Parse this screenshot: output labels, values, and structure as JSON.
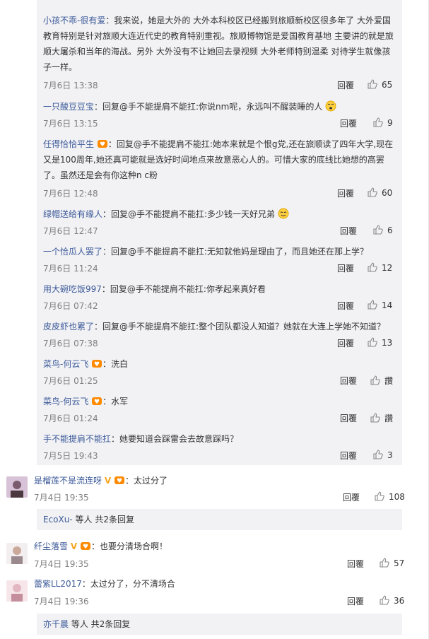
{
  "replies": [
    {
      "name": "小孩不乖-很有爱",
      "text": "：我来说，她是大外的 大外本科校区已经搬到旅顺新校区很多年了 大外爱国教育特别是针对旅顺大连近代史的教育特别重视。旅顺博物馆是爱国教育基地 主要讲的就是旅顺大屠杀和当年的海战。另外 大外没有不让她回去录视频 大外老师特别温柔 对待学生就像孩子一样。",
      "time": "7月6日 13:38",
      "reply": "回覆",
      "likes": "65"
    },
    {
      "name": "一只酸豆豆宝",
      "text": "：回复@手不能提肩不能扛:你说nm呢，永远叫不醒装睡的人",
      "time": "7月6日 13:15",
      "reply": "回覆",
      "likes": "9"
    },
    {
      "name": "任得恰恰平生",
      "text": "：回复@手不能提肩不能扛:她本来就是个恨g党,还在旅顺读了四年大学,现在又是100周年,她还真可能就是选好时间地点来故意恶心人的。可惜大家的底线比她想的高罢了。虽然还是会有你这种n c粉",
      "time": "7月6日 12:48",
      "reply": "回覆",
      "likes": "60"
    },
    {
      "name": "绿帽送给有缘人",
      "text": "：回复@手不能提肩不能扛:多少钱一天好兄弟",
      "time": "7月6日 12:47",
      "reply": "回覆",
      "likes": "6"
    },
    {
      "name": "一个恰瓜人罢了",
      "text": "：回复@手不能提肩不能扛:无知就他妈是理由了，而且她还在那上学？",
      "time": "7月6日 11:24",
      "reply": "回覆",
      "likes": "12"
    },
    {
      "name": "用大碗吃饭997",
      "text": "：回复@手不能提肩不能扛:你孝起来真好看",
      "time": "7月6日 07:42",
      "reply": "回覆",
      "likes": "14"
    },
    {
      "name": "皮皮虾也累了",
      "text": "：回复@手不能提肩不能扛:整个团队都没人知道？她就在大连上学她不知道？",
      "time": "7月6日 07:38",
      "reply": "回覆",
      "likes": "13"
    },
    {
      "name": "菜鸟-何云飞",
      "text": "：洗白",
      "time": "7月6日 01:25",
      "reply": "回覆",
      "likes": "讚"
    },
    {
      "name": "菜鸟-何云飞",
      "text": "：水军",
      "time": "7月6日 01:24",
      "reply": "回覆",
      "likes": "讚"
    },
    {
      "name": "手不能提肩不能扛",
      "text": "：她要知道会踩雷会去故意踩吗？",
      "time": "7月5日 19:43",
      "reply": "回覆",
      "likes": "3"
    }
  ],
  "comments": [
    {
      "name": "是榴莲不是流连呀",
      "text": "：太过分了",
      "time": "7月4日 19:35",
      "reply": "回覆",
      "likes": "108",
      "more_name": "EcoXu-",
      "more_text": " 等人 共2条回复"
    },
    {
      "name": "纤尘落雪",
      "text": "：也要分清场合啊！",
      "time": "7月4日 19:35",
      "reply": "回覆",
      "likes": "57"
    },
    {
      "name": "蕾紫LL2017",
      "text": "：太过分了，分不清场合",
      "time": "7月4日 19:36",
      "reply": "回覆",
      "likes": "36",
      "more_name": "亦千晨",
      "more_text": " 等人 共2条回复"
    }
  ],
  "colors": {
    "link": "#3b5998",
    "meta": "#808080",
    "reply_bg": "#f2f2f5"
  },
  "icons": {
    "like": "thumb-up-icon",
    "vip": "vip-v-icon",
    "fan_badge": "fan-badge-icon",
    "emoji": "emoji-icon"
  }
}
